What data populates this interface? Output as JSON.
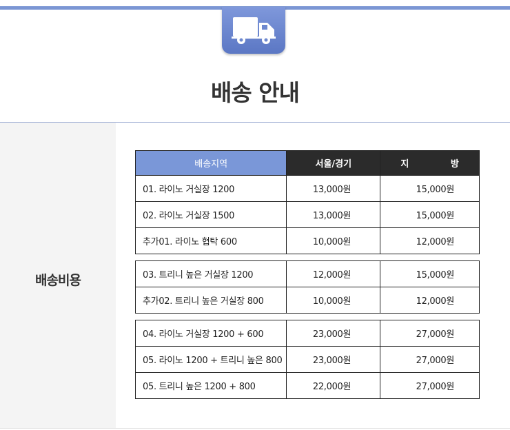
{
  "header": {
    "title": "배송 안내",
    "badge_icon": "truck-icon",
    "accent_color": "#7b96d4"
  },
  "section": {
    "label": "배송비용"
  },
  "table": {
    "columns": {
      "region": "배송지역",
      "seoul": "서울/경기",
      "local": "지 방"
    },
    "groups": [
      [
        {
          "region": "01. 라이노 거실장 1200",
          "seoul": "13,000원",
          "local": "15,000원"
        },
        {
          "region": "02. 라이노 거실장 1500",
          "seoul": "13,000원",
          "local": "15,000원"
        },
        {
          "region": "추가01. 라이노 협탁 600",
          "seoul": "10,000원",
          "local": "12,000원"
        }
      ],
      [
        {
          "region": "03. 트리니 높은 거실장 1200",
          "seoul": "12,000원",
          "local": "15,000원"
        },
        {
          "region": "추가02. 트리니 높은 거실장 800",
          "seoul": "10,000원",
          "local": "12,000원"
        }
      ],
      [
        {
          "region": "04. 라이노 거실장 1200 + 600",
          "seoul": "23,000원",
          "local": "27,000원"
        },
        {
          "region": "05. 라이노 1200 + 트리니 높은 800",
          "seoul": "23,000원",
          "local": "27,000원"
        },
        {
          "region": "05. 트리니 높은 1200 + 800",
          "seoul": "22,000원",
          "local": "27,000원"
        }
      ]
    ]
  }
}
